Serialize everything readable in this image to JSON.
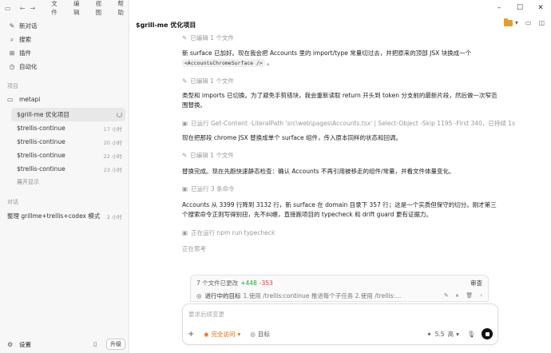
{
  "menubar": {
    "items": [
      "文件",
      "编辑",
      "视图",
      "帮助"
    ]
  },
  "nav": {
    "new_chat": "新对话",
    "search": "搜索",
    "plugins": "插件",
    "automation": "自动化"
  },
  "projects": {
    "label": "项目",
    "folder": "metapi",
    "threads": [
      {
        "title": "$grill-me 优化项目",
        "time": "",
        "active": true
      },
      {
        "title": "$trellis-continue",
        "time": "17 小时"
      },
      {
        "title": "$trellis-continue",
        "time": "20 小时"
      },
      {
        "title": "$trellis-continue",
        "time": "22 小时"
      },
      {
        "title": "$trellis-continue",
        "time": "23 小时"
      }
    ],
    "show_more": "展开显示"
  },
  "chats": {
    "label": "对话",
    "items": [
      {
        "title": "整理 grillme+trellis+codex 模式",
        "time": "2 小时"
      }
    ]
  },
  "footer": {
    "settings": "设置",
    "upgrade": "升级"
  },
  "main": {
    "title": "$grill-me 优化项目",
    "status_edited_top": "已编辑 1 个文件",
    "para1_a": "新 surface 已加好。现在我会把 Accounts 里的 import/type 常量切过去，并把原来的顶部 JSX 块换成一个",
    "para1_code": "<AccountsChromeSurface />",
    "para1_b": "。",
    "status_edited_1": "已编辑 1 个文件",
    "para2": "类型和 imports 已切换。为了避免手剪错块，我会重新读取 return 开头到 token 分支前的最新片段，然后做一次窄范围替换。",
    "status_ran_1": "已运行 Get-Content -LiteralPath 'src\\web\\pages\\Accounts.tsx' | Select-Object -Skip 1195 -First 340，已持续 1s",
    "para3": "现在把那段 chrome JSX 替换成单个 surface 组件，传入原本同样的状态和回调。",
    "status_edited_2": "已编辑 1 个文件",
    "para4": "替换完成。现在先跑快速静态检查：确认 Accounts 不再引用被移走的组件/常量，并看文件体量变化。",
    "status_ran_3": "已运行 3 条命令",
    "para5": "Accounts 从 3399 行降到 3132 行，新 surface 在 domain 目录下 357 行；这是一个实质但保守的切分。刚才第三个搜索命令正则写得别扭，先不纠缠，直接跑项目的 typecheck 和 drift guard 更有证据力。",
    "status_running": "正在运行 npm run typecheck",
    "thinking": "正在思考"
  },
  "changes": {
    "files": "7 个文件已更改",
    "plus": "+448",
    "minus": "-353",
    "review": "审查",
    "goal_label": "进行中的目标",
    "goal_text": "1.使用 /trellis:continue 推进每个子任务 2.使用 /trellis:finish-wor... 27..."
  },
  "composer": {
    "placeholder": "要求后续变更",
    "permission": "完全访问",
    "goal": "目标",
    "model": "5.5",
    "effort": "高"
  },
  "colors": {
    "accent_orange": "#e06a00",
    "plus_green": "#2a9d3c",
    "minus_red": "#d04040",
    "folder_yellow": "#e0a030"
  }
}
